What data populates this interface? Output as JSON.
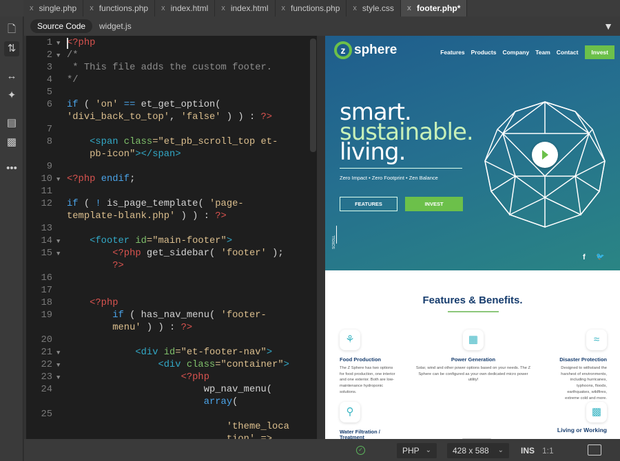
{
  "tabs": [
    {
      "label": "single.php",
      "active": false
    },
    {
      "label": "functions.php",
      "active": false
    },
    {
      "label": "index.html",
      "active": false
    },
    {
      "label": "index.html",
      "active": false
    },
    {
      "label": "functions.php",
      "active": false
    },
    {
      "label": "style.css",
      "active": false
    },
    {
      "label": "footer.php*",
      "active": true
    }
  ],
  "tab_close_glyph": "x",
  "subtabs": [
    {
      "label": "Source Code",
      "active": true
    },
    {
      "label": "widget.js",
      "active": false
    }
  ],
  "toolbar_icons": [
    "file-icon",
    "sort-icon",
    "expand-icon",
    "code-hint-icon",
    "comment-icon",
    "uncomment-icon",
    "more-icon"
  ],
  "code_colors": {
    "php": "#d9534f",
    "keyword": "#4aa3e8",
    "string": "#dcbf8e",
    "comment": "#8c8c8c",
    "tag": "#32a8c6",
    "attr": "#7fbf6a"
  },
  "code": [
    {
      "n": "1",
      "fold": true,
      "rows": [
        [
          [
            "<?php",
            "php"
          ]
        ]
      ]
    },
    {
      "n": "2",
      "fold": true,
      "rows": [
        [
          [
            "/*",
            "com"
          ]
        ]
      ]
    },
    {
      "n": "3",
      "rows": [
        [
          [
            " * This file adds the custom footer.",
            "com"
          ]
        ]
      ]
    },
    {
      "n": "4",
      "rows": [
        [
          [
            "*/",
            "com"
          ]
        ]
      ]
    },
    {
      "n": "5",
      "rows": [
        []
      ]
    },
    {
      "n": "6",
      "rows": [
        [
          [
            "if",
            "kw"
          ],
          [
            " ( ",
            "def"
          ],
          [
            "'on'",
            "str"
          ],
          [
            " == ",
            "kw"
          ],
          [
            "et_get_option(",
            "def"
          ]
        ],
        [
          [
            "'divi_back_to_top'",
            "str"
          ],
          [
            ", ",
            "def"
          ],
          [
            "'false'",
            "str"
          ],
          [
            " ) ) : ",
            "def"
          ],
          [
            "?>",
            "php"
          ]
        ]
      ]
    },
    {
      "n": "7",
      "rows": [
        []
      ]
    },
    {
      "n": "8",
      "rows": [
        [
          [
            "    <span ",
            "tag"
          ],
          [
            "class",
            "attr"
          ],
          [
            "=\"et_pb_scroll_top et-",
            "str"
          ]
        ],
        [
          [
            "    pb-icon\"",
            "str"
          ],
          [
            "></span>",
            "tag"
          ]
        ]
      ]
    },
    {
      "n": "9",
      "rows": [
        []
      ]
    },
    {
      "n": "10",
      "fold": true,
      "rows": [
        [
          [
            "<?php ",
            "php"
          ],
          [
            "endif",
            "kw"
          ],
          [
            ";",
            "def"
          ]
        ]
      ]
    },
    {
      "n": "11",
      "rows": [
        []
      ]
    },
    {
      "n": "12",
      "rows": [
        [
          [
            "if",
            "kw"
          ],
          [
            " ( ",
            "def"
          ],
          [
            "!",
            "kw"
          ],
          [
            " is_page_template( ",
            "def"
          ],
          [
            "'page-",
            "str"
          ]
        ],
        [
          [
            "template-blank.php'",
            "str"
          ],
          [
            " ) ) : ",
            "def"
          ],
          [
            "?>",
            "php"
          ]
        ]
      ]
    },
    {
      "n": "13",
      "rows": [
        []
      ]
    },
    {
      "n": "14",
      "fold": true,
      "rows": [
        [
          [
            "    <footer ",
            "tag"
          ],
          [
            "id",
            "attr"
          ],
          [
            "=\"main-footer\"",
            "str"
          ],
          [
            ">",
            "tag"
          ]
        ]
      ]
    },
    {
      "n": "15",
      "fold": true,
      "rows": [
        [
          [
            "        <?php ",
            "php"
          ],
          [
            "get_sidebar( ",
            "def"
          ],
          [
            "'footer'",
            "str"
          ],
          [
            " );",
            "def"
          ]
        ],
        [
          [
            "        ?>",
            "php"
          ]
        ]
      ]
    },
    {
      "n": "16",
      "rows": [
        []
      ]
    },
    {
      "n": "17",
      "rows": [
        []
      ]
    },
    {
      "n": "18",
      "rows": [
        [
          [
            "    <?php",
            "php"
          ]
        ]
      ]
    },
    {
      "n": "19",
      "rows": [
        [
          [
            "        if",
            "kw"
          ],
          [
            " ( has_nav_menu( ",
            "def"
          ],
          [
            "'footer-",
            "str"
          ]
        ],
        [
          [
            "        menu'",
            "str"
          ],
          [
            " ) ) : ",
            "def"
          ],
          [
            "?>",
            "php"
          ]
        ]
      ]
    },
    {
      "n": "20",
      "rows": [
        []
      ]
    },
    {
      "n": "21",
      "fold": true,
      "rows": [
        [
          [
            "            <div ",
            "tag"
          ],
          [
            "id",
            "attr"
          ],
          [
            "=\"et-footer-nav\"",
            "str"
          ],
          [
            ">",
            "tag"
          ]
        ]
      ]
    },
    {
      "n": "22",
      "fold": true,
      "rows": [
        [
          [
            "                <div ",
            "tag"
          ],
          [
            "class",
            "attr"
          ],
          [
            "=\"container\"",
            "str"
          ],
          [
            ">",
            "tag"
          ]
        ]
      ]
    },
    {
      "n": "23",
      "fold": true,
      "rows": [
        [
          [
            "                    <?php",
            "php"
          ]
        ]
      ]
    },
    {
      "n": "24",
      "rows": [
        [
          [
            "                        wp_nav_menu(",
            "def"
          ]
        ],
        [
          [
            "                        array",
            "kw"
          ],
          [
            "(",
            "def"
          ]
        ]
      ]
    },
    {
      "n": "25",
      "rows": [
        [],
        [
          [
            "                            'theme_loca",
            "str"
          ]
        ],
        [
          [
            "                            tion' =>",
            "str"
          ]
        ]
      ]
    }
  ],
  "preview": {
    "logo_letter": "z",
    "logo_word": "sphere",
    "nav": [
      "Features",
      "Products",
      "Company",
      "Team",
      "Contact"
    ],
    "nav_cta": "Invest",
    "headline": [
      "smart.",
      "sustainable.",
      "living."
    ],
    "tagline": "Zero Impact • Zero Footprint • Zen Balance",
    "btn_features": "FEATURES",
    "btn_invest": "INVEST",
    "scroll": "SCROLL",
    "social": [
      "facebook-icon",
      "twitter-icon"
    ],
    "section_title": "Features & Benefits.",
    "features": [
      {
        "title": "Food Production",
        "text": "The Z Sphere has two options for food production, one interior and one exterior. Both are low-maintenance hydroponic solutions.",
        "icon": "food-icon"
      },
      {
        "title": "Power Generation",
        "text": "Solar, wind and other power options based on your needs. The Z Sphere can be configured as your own dedicated micro power utility!",
        "icon": "solar-panel-icon"
      },
      {
        "title": "Disaster Protection",
        "text": "Designed to withstand the harshest of environments, including hurricanes, typhoons, floods, earthquakes, wildfires, extreme cold and more.",
        "icon": "tornado-icon"
      },
      {
        "title": "Water Filtration / Treatment",
        "text": "",
        "icon": "test-tube-icon"
      },
      {
        "title": "Living or Working",
        "text": "",
        "icon": "couch-icon"
      }
    ],
    "colors": {
      "brand_green": "#6cc04a",
      "brand_navy": "#173d6e"
    }
  },
  "status": {
    "language": "PHP",
    "size": "428 x 588",
    "mode": "INS",
    "position": "1:1"
  }
}
